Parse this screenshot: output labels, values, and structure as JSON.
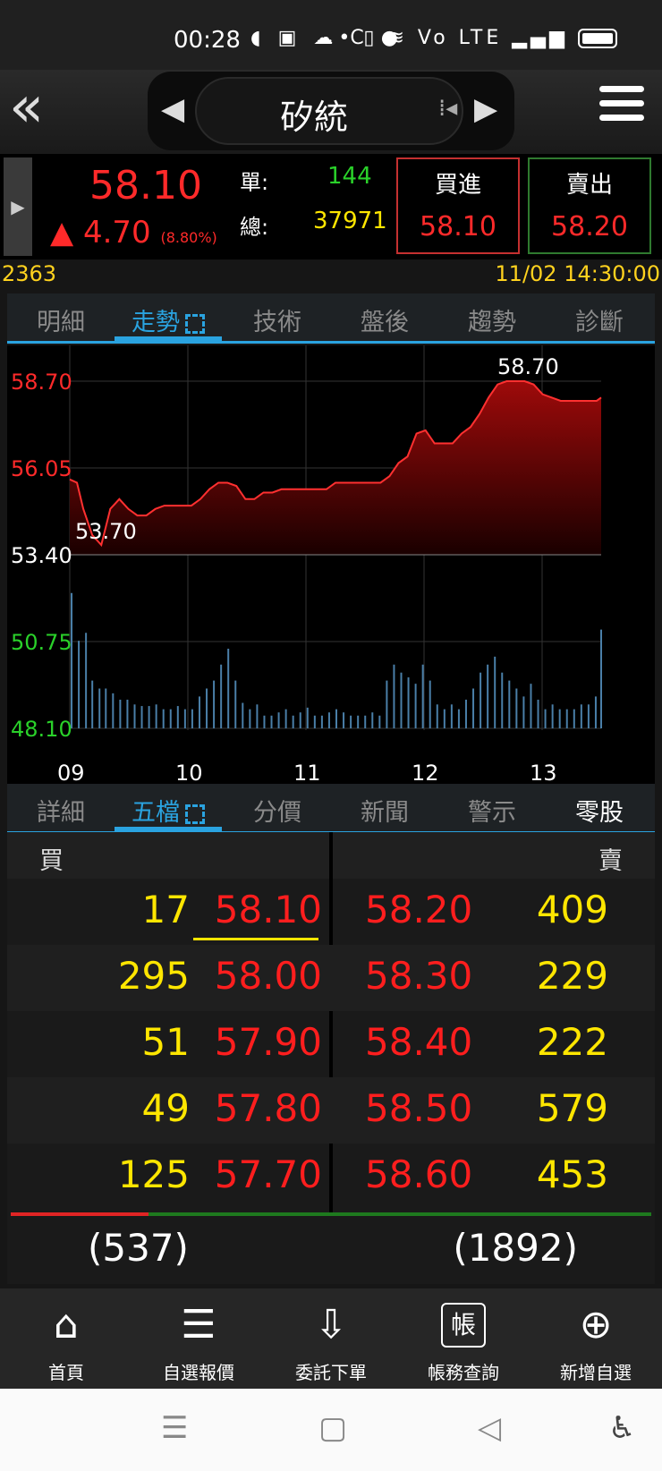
{
  "status_bar": {
    "time": "00:28",
    "icons": [
      "message-icon",
      "play-together-icon",
      "game-icon",
      "c-icon",
      "line-icon"
    ],
    "right_icons": [
      "dot",
      "vibrate-icon",
      "wifi-icon",
      "volte-icon",
      "signal-icon",
      "battery-icon"
    ],
    "icons_text": "◖ ▣ ☁ C ● ",
    "right_text": "• ▯ ≋ Vo LTE ▂▄▆"
  },
  "header": {
    "back_glyph": "«",
    "title": "矽統",
    "prev_glyph": "◀",
    "next_glyph": "▶",
    "drag_glyph": "⁞◂"
  },
  "quote": {
    "side_arrow": "▶",
    "price": "58.10",
    "change": "▲ 4.70",
    "change_pct": "(8.80%)",
    "single_label": "單:",
    "single_qty": "144",
    "total_label": "總:",
    "total_qty": "37971",
    "buy_label": "買進",
    "buy_price": "58.10",
    "sell_label": "賣出",
    "sell_price": "58.20"
  },
  "info": {
    "code": "2363",
    "datetime": "11/02 14:30:00"
  },
  "tabs_top": [
    {
      "label": "明細"
    },
    {
      "label": "走勢"
    },
    {
      "label": "技術"
    },
    {
      "label": "盤後"
    },
    {
      "label": "趨勢"
    },
    {
      "label": "診斷"
    }
  ],
  "tabs_bottom": [
    {
      "label": "詳細"
    },
    {
      "label": "五檔"
    },
    {
      "label": "分價"
    },
    {
      "label": "新聞"
    },
    {
      "label": "警示"
    },
    {
      "label": "零股"
    }
  ],
  "chart_data": {
    "type": "area",
    "y_ticks": [
      "58.70",
      "56.05",
      "53.40",
      "50.75",
      "48.10"
    ],
    "x_ticks": [
      "09",
      "10",
      "11",
      "12",
      "13"
    ],
    "high_label": "58.70",
    "low_label": "53.70",
    "ref_price": 53.4,
    "ylim": [
      48.1,
      58.7
    ],
    "colors": {
      "up": "#ff2a2a",
      "down": "#2ad12a",
      "ref": "#ffffff",
      "volume": "#4a7fa8"
    },
    "price": [
      [
        0,
        55.7
      ],
      [
        8,
        55.6
      ],
      [
        15,
        54.8
      ],
      [
        25,
        54.0
      ],
      [
        35,
        53.7
      ],
      [
        45,
        54.8
      ],
      [
        55,
        55.1
      ],
      [
        65,
        54.8
      ],
      [
        75,
        54.6
      ],
      [
        85,
        54.6
      ],
      [
        95,
        54.8
      ],
      [
        105,
        54.9
      ],
      [
        115,
        54.9
      ],
      [
        125,
        54.9
      ],
      [
        135,
        54.9
      ],
      [
        145,
        55.1
      ],
      [
        155,
        55.4
      ],
      [
        165,
        55.6
      ],
      [
        175,
        55.6
      ],
      [
        185,
        55.5
      ],
      [
        195,
        55.1
      ],
      [
        205,
        55.1
      ],
      [
        215,
        55.3
      ],
      [
        225,
        55.3
      ],
      [
        235,
        55.4
      ],
      [
        245,
        55.4
      ],
      [
        255,
        55.4
      ],
      [
        265,
        55.4
      ],
      [
        275,
        55.4
      ],
      [
        285,
        55.4
      ],
      [
        295,
        55.6
      ],
      [
        305,
        55.6
      ],
      [
        315,
        55.6
      ],
      [
        325,
        55.6
      ],
      [
        335,
        55.6
      ],
      [
        345,
        55.6
      ],
      [
        355,
        55.8
      ],
      [
        365,
        56.2
      ],
      [
        375,
        56.4
      ],
      [
        385,
        57.1
      ],
      [
        395,
        57.2
      ],
      [
        405,
        56.8
      ],
      [
        415,
        56.8
      ],
      [
        425,
        56.8
      ],
      [
        435,
        57.1
      ],
      [
        445,
        57.3
      ],
      [
        455,
        57.7
      ],
      [
        465,
        58.2
      ],
      [
        475,
        58.6
      ],
      [
        485,
        58.7
      ],
      [
        495,
        58.7
      ],
      [
        505,
        58.7
      ],
      [
        515,
        58.6
      ],
      [
        525,
        58.3
      ],
      [
        535,
        58.2
      ],
      [
        545,
        58.1
      ],
      [
        555,
        58.1
      ],
      [
        565,
        58.1
      ],
      [
        575,
        58.1
      ],
      [
        585,
        58.1
      ],
      [
        590,
        58.2
      ]
    ],
    "volume": [
      [
        2,
        0.85
      ],
      [
        10,
        0.55
      ],
      [
        18,
        0.6
      ],
      [
        25,
        0.3
      ],
      [
        33,
        0.25
      ],
      [
        40,
        0.25
      ],
      [
        48,
        0.22
      ],
      [
        56,
        0.18
      ],
      [
        64,
        0.18
      ],
      [
        72,
        0.15
      ],
      [
        80,
        0.14
      ],
      [
        88,
        0.14
      ],
      [
        96,
        0.15
      ],
      [
        104,
        0.12
      ],
      [
        112,
        0.12
      ],
      [
        120,
        0.14
      ],
      [
        128,
        0.12
      ],
      [
        136,
        0.12
      ],
      [
        144,
        0.2
      ],
      [
        152,
        0.25
      ],
      [
        160,
        0.3
      ],
      [
        168,
        0.4
      ],
      [
        176,
        0.5
      ],
      [
        184,
        0.3
      ],
      [
        192,
        0.16
      ],
      [
        200,
        0.12
      ],
      [
        208,
        0.15
      ],
      [
        216,
        0.08
      ],
      [
        224,
        0.08
      ],
      [
        232,
        0.1
      ],
      [
        240,
        0.12
      ],
      [
        248,
        0.08
      ],
      [
        256,
        0.1
      ],
      [
        264,
        0.13
      ],
      [
        272,
        0.08
      ],
      [
        280,
        0.08
      ],
      [
        288,
        0.1
      ],
      [
        296,
        0.12
      ],
      [
        304,
        0.1
      ],
      [
        312,
        0.08
      ],
      [
        320,
        0.08
      ],
      [
        328,
        0.08
      ],
      [
        336,
        0.1
      ],
      [
        344,
        0.08
      ],
      [
        352,
        0.3
      ],
      [
        360,
        0.4
      ],
      [
        368,
        0.35
      ],
      [
        376,
        0.32
      ],
      [
        384,
        0.28
      ],
      [
        392,
        0.4
      ],
      [
        400,
        0.3
      ],
      [
        408,
        0.15
      ],
      [
        416,
        0.12
      ],
      [
        424,
        0.15
      ],
      [
        432,
        0.12
      ],
      [
        440,
        0.18
      ],
      [
        448,
        0.25
      ],
      [
        456,
        0.35
      ],
      [
        464,
        0.4
      ],
      [
        472,
        0.45
      ],
      [
        480,
        0.35
      ],
      [
        488,
        0.3
      ],
      [
        496,
        0.25
      ],
      [
        504,
        0.2
      ],
      [
        512,
        0.28
      ],
      [
        520,
        0.18
      ],
      [
        528,
        0.12
      ],
      [
        536,
        0.15
      ],
      [
        544,
        0.12
      ],
      [
        552,
        0.12
      ],
      [
        560,
        0.12
      ],
      [
        568,
        0.15
      ],
      [
        576,
        0.15
      ],
      [
        584,
        0.2
      ],
      [
        590,
        0.62
      ]
    ],
    "x_max": 590
  },
  "order_book": {
    "buy_label": "買",
    "sell_label": "賣",
    "rows": [
      {
        "bid_qty": "17",
        "bid_price": "58.10",
        "ask_price": "58.20",
        "ask_qty": "409"
      },
      {
        "bid_qty": "295",
        "bid_price": "58.00",
        "ask_price": "58.30",
        "ask_qty": "229"
      },
      {
        "bid_qty": "51",
        "bid_price": "57.90",
        "ask_price": "58.40",
        "ask_qty": "222"
      },
      {
        "bid_qty": "49",
        "bid_price": "57.80",
        "ask_price": "58.50",
        "ask_qty": "579"
      },
      {
        "bid_qty": "125",
        "bid_price": "57.70",
        "ask_price": "58.60",
        "ask_qty": "453"
      }
    ],
    "bid_total": "(537)",
    "ask_total": "(1892)"
  },
  "bottom_nav": [
    {
      "label": "首頁",
      "icon": "home-icon",
      "glyph": "⌂"
    },
    {
      "label": "自選報價",
      "icon": "watchlist-icon",
      "glyph": "☰"
    },
    {
      "label": "委託下單",
      "icon": "order-icon",
      "glyph": "⇩"
    },
    {
      "label": "帳務查詢",
      "icon": "account-icon",
      "glyph": "帳"
    },
    {
      "label": "新增自選",
      "icon": "add-circle-icon",
      "glyph": "⊕"
    }
  ],
  "system_nav": {
    "menu": "☰",
    "home": "▢",
    "back": "◁",
    "accessibility": "♿"
  }
}
